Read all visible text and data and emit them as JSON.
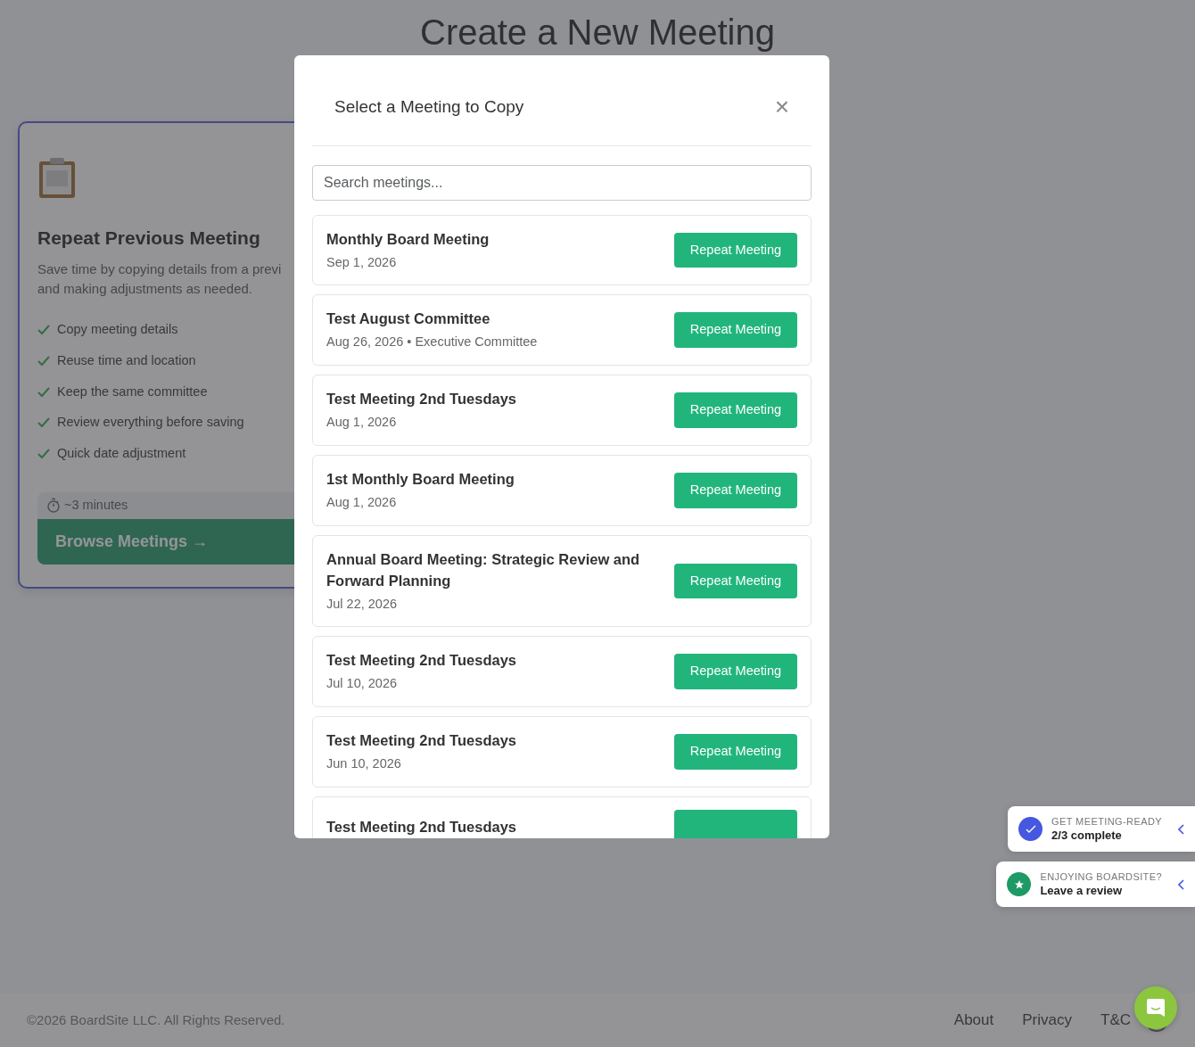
{
  "page": {
    "title": "Create a New Meeting"
  },
  "option_card": {
    "title": "Repeat Previous Meeting",
    "description_lines": [
      "Save time by copying details from a previ",
      "and making adjustments as needed."
    ],
    "features": [
      "Copy meeting details",
      "Reuse time and location",
      "Keep the same committee",
      "Review everything before saving",
      "Quick date adjustment"
    ],
    "duration": "~3 minutes",
    "button": "Browse Meetings →"
  },
  "modal": {
    "title": "Select a Meeting to Copy",
    "close": "×",
    "search": {
      "placeholder": "Search meetings..."
    },
    "meetings": [
      {
        "name": "Monthly Board Meeting",
        "meta": "Sep 1, 2026",
        "button": "Repeat Meeting"
      },
      {
        "name": "Test August Committee",
        "meta": "Aug 26, 2026 • Executive Committee",
        "button": "Repeat Meeting"
      },
      {
        "name": "Test Meeting 2nd Tuesdays",
        "meta": "Aug 1, 2026",
        "button": "Repeat Meeting"
      },
      {
        "name": "1st Monthly Board Meeting",
        "meta": "Aug 1, 2026",
        "button": "Repeat Meeting"
      },
      {
        "name": "Annual Board Meeting: Strategic Review and Forward Planning",
        "meta": "Jul 22, 2026",
        "button": "Repeat Meeting"
      },
      {
        "name": "Test Meeting 2nd Tuesdays",
        "meta": "Jul 10, 2026",
        "button": "Repeat Meeting"
      },
      {
        "name": "Test Meeting 2nd Tuesdays",
        "meta": "Jun 10, 2026",
        "button": "Repeat Meeting"
      },
      {
        "name": "Test Meeting 2nd Tuesdays"
      }
    ]
  },
  "widgets": [
    {
      "kind": "progress",
      "label": "GET MEETING-READY",
      "text": "2/3 complete",
      "color": "#4657e0"
    },
    {
      "kind": "review",
      "label": "ENJOYING BOARDSITE?",
      "text": "Leave a review",
      "color": "#1e9a66"
    }
  ],
  "footer": {
    "copyright": "©2026 BoardSite LLC. All Rights Reserved.",
    "links": [
      "About",
      "Privacy",
      "T&C"
    ]
  }
}
